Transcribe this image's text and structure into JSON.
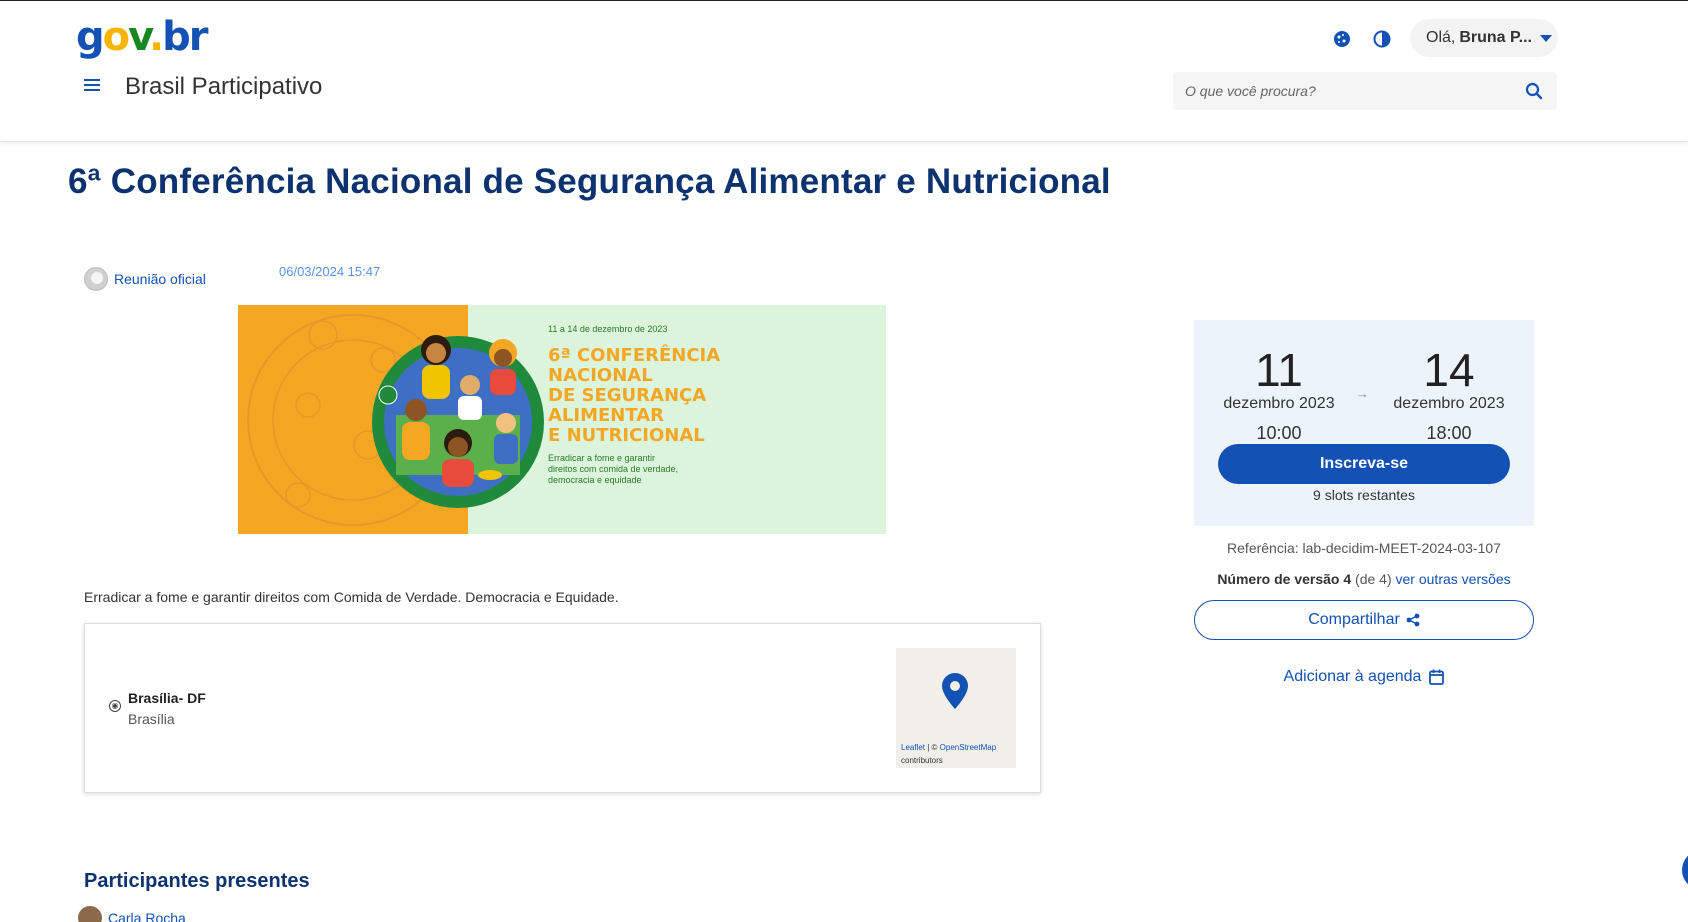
{
  "header": {
    "logo": {
      "g": "g",
      "o": "o",
      "v": "v",
      "dot": ".",
      "b": "b",
      "r": "r"
    },
    "site_title": "Brasil Participativo",
    "user": {
      "greeting": "Olá,",
      "name": "Bruna P..."
    },
    "search": {
      "placeholder": "O que você procura?"
    },
    "icons": [
      "cookie-icon",
      "contrast-icon",
      "search-icon",
      "menu-icon"
    ]
  },
  "meeting": {
    "title": "6ª Conferência Nacional de Segurança Alimentar e Nutricional",
    "author": "Reunião oficial",
    "published": "06/03/2024 15:47",
    "banner": {
      "date_line": "11 a 14 de dezembro de 2023",
      "title_lines": [
        "6ª CONFERÊNCIA",
        "NACIONAL",
        "DE SEGURANÇA",
        "ALIMENTAR",
        "E NUTRICIONAL"
      ],
      "tagline_lines": [
        "Erradicar a fome e garantir",
        "direitos com comida de verdade,",
        "democracia e equidade"
      ]
    },
    "description": "Erradicar a fome e garantir direitos com Comida de Verdade. Democracia e Equidade.",
    "address": {
      "title": "Brasília- DF",
      "subtitle": "Brasília",
      "map_attribution": {
        "leaflet": "Leaflet",
        "sep": " | © ",
        "osm": "OpenStreetMap",
        "contributors": "contributors"
      }
    }
  },
  "sidebar": {
    "start": {
      "day": "11",
      "month": "dezembro 2023",
      "time": "10:00"
    },
    "end": {
      "day": "14",
      "month": "dezembro 2023",
      "time": "18:00"
    },
    "arrow": "→",
    "register_label": "Inscreva-se",
    "slots": "9 slots restantes",
    "reference": "Referência: lab-decidim-MEET-2024-03-107",
    "version": {
      "label": "Número de versão 4",
      "of": " (de 4) ",
      "link": "ver outras versões"
    },
    "share_label": "Compartilhar",
    "agenda_label": "Adicionar à agenda"
  },
  "participants": {
    "heading": "Participantes presentes",
    "items": [
      {
        "name": "Carla Rocha"
      }
    ]
  },
  "colors": {
    "primary": "#1351b4",
    "title": "#0c326f",
    "banner_orange": "#f5a623",
    "banner_green": "#dcf3dc"
  }
}
